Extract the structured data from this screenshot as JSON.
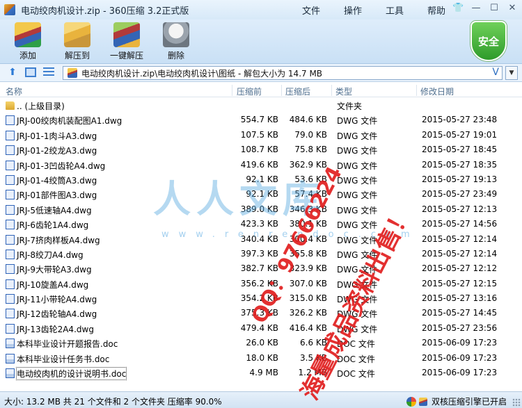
{
  "window": {
    "title": "电动绞肉机设计.zip - 360压缩 3.2正式版",
    "menu": [
      "文件",
      "操作",
      "工具",
      "帮助"
    ]
  },
  "toolbar": {
    "add": "添加",
    "extract": "解压到",
    "oneclick": "一键解压",
    "delete": "删除",
    "safe_badge": "安全"
  },
  "address": {
    "path": "电动绞肉机设计.zip\\电动绞肉机设计\\图纸 - 解包大小为 14.7 MB"
  },
  "columns": {
    "name": "名称",
    "size": "压缩前",
    "packed": "压缩后",
    "type": "类型",
    "date": "修改日期"
  },
  "files": [
    {
      "name": ".. (上级目录)",
      "size": "",
      "packed": "",
      "type": "文件夹",
      "date": "",
      "kind": "folder"
    },
    {
      "name": "JRJ-00绞肉机装配图A1.dwg",
      "size": "554.7 KB",
      "packed": "484.6 KB",
      "type": "DWG 文件",
      "date": "2015-05-27 23:48",
      "kind": "dwg"
    },
    {
      "name": "JRJ-01-1肉斗A3.dwg",
      "size": "107.5 KB",
      "packed": "79.0 KB",
      "type": "DWG 文件",
      "date": "2015-05-27 19:01",
      "kind": "dwg"
    },
    {
      "name": "JRJ-01-2绞龙A3.dwg",
      "size": "108.7 KB",
      "packed": "75.8 KB",
      "type": "DWG 文件",
      "date": "2015-05-27 18:45",
      "kind": "dwg"
    },
    {
      "name": "JRJ-01-3凹齿轮A4.dwg",
      "size": "419.6 KB",
      "packed": "362.9 KB",
      "type": "DWG 文件",
      "date": "2015-05-27 18:35",
      "kind": "dwg"
    },
    {
      "name": "JRJ-01-4绞筒A3.dwg",
      "size": "92.1 KB",
      "packed": "53.6 KB",
      "type": "DWG 文件",
      "date": "2015-05-27 19:13",
      "kind": "dwg"
    },
    {
      "name": "JRJ-01部件图A3.dwg",
      "size": "92.1 KB",
      "packed": "57.4 KB",
      "type": "DWG 文件",
      "date": "2015-05-27 23:49",
      "kind": "dwg"
    },
    {
      "name": "JRJ-5低速轴A4.dwg",
      "size": "389.0 KB",
      "packed": "346.3 KB",
      "type": "DWG 文件",
      "date": "2015-05-27 12:13",
      "kind": "dwg"
    },
    {
      "name": "JRJ-6齿轮1A4.dwg",
      "size": "423.3 KB",
      "packed": "380.1 KB",
      "type": "DWG 文件",
      "date": "2015-05-27 14:56",
      "kind": "dwg"
    },
    {
      "name": "JRJ-7挤肉样板A4.dwg",
      "size": "340.4 KB",
      "packed": "300.4 KB",
      "type": "DWG 文件",
      "date": "2015-05-27 12:14",
      "kind": "dwg"
    },
    {
      "name": "JRJ-8绞刀A4.dwg",
      "size": "397.3 KB",
      "packed": "355.8 KB",
      "type": "DWG 文件",
      "date": "2015-05-27 12:14",
      "kind": "dwg"
    },
    {
      "name": "JRJ-9大带轮A3.dwg",
      "size": "382.7 KB",
      "packed": "323.9 KB",
      "type": "DWG 文件",
      "date": "2015-05-27 12:12",
      "kind": "dwg"
    },
    {
      "name": "JRJ-10旋盖A4.dwg",
      "size": "356.2 KB",
      "packed": "307.0 KB",
      "type": "DWG 文件",
      "date": "2015-05-27 12:15",
      "kind": "dwg"
    },
    {
      "name": "JRJ-11小带轮A4.dwg",
      "size": "354.2 KB",
      "packed": "315.0 KB",
      "type": "DWG 文件",
      "date": "2015-05-27 13:16",
      "kind": "dwg"
    },
    {
      "name": "JRJ-12齿轮轴A4.dwg",
      "size": "375.3 KB",
      "packed": "326.2 KB",
      "type": "DWG 文件",
      "date": "2015-05-27 14:45",
      "kind": "dwg"
    },
    {
      "name": "JRJ-13齿轮2A4.dwg",
      "size": "479.4 KB",
      "packed": "416.4 KB",
      "type": "DWG 文件",
      "date": "2015-05-27 23:56",
      "kind": "dwg"
    },
    {
      "name": "本科毕业设计开题报告.doc",
      "size": "26.0 KB",
      "packed": "6.6 KB",
      "type": "DOC 文件",
      "date": "2015-06-09 17:23",
      "kind": "doc"
    },
    {
      "name": "本科毕业设计任务书.doc",
      "size": "18.0 KB",
      "packed": "3.5 KB",
      "type": "DOC 文件",
      "date": "2015-06-09 17:23",
      "kind": "doc"
    },
    {
      "name": "电动绞肉机的设计说明书.doc",
      "size": "4.9 MB",
      "packed": "1.2 MB",
      "type": "DOC 文件",
      "date": "2015-06-09 17:23",
      "kind": "doc",
      "selected": true
    }
  ],
  "status": {
    "left": "大小: 13.2 MB 共 21 个文件和 2 个文件夹 压缩率 90.0%",
    "right": "双核压缩引擎已开启"
  },
  "watermark": {
    "logo": "人人文库",
    "url": "www.renrendoc.com"
  },
  "stamp": {
    "qq": "QQ：97666224",
    "sale": "海量成品资料出售！"
  }
}
